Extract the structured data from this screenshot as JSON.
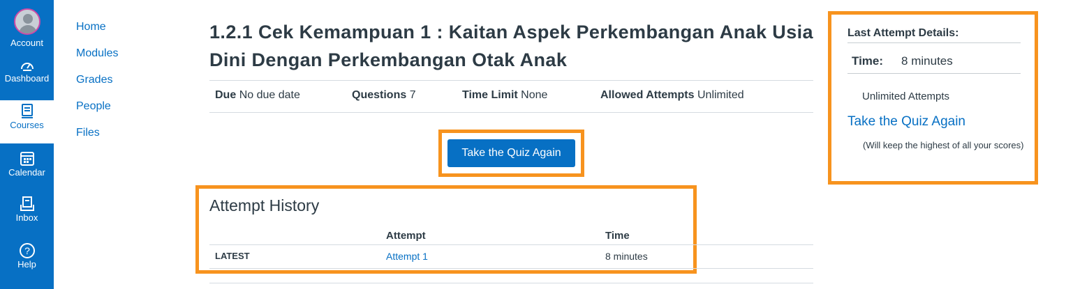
{
  "global_nav": {
    "items": [
      {
        "label": "Account",
        "icon": "avatar"
      },
      {
        "label": "Dashboard",
        "icon": "dashboard-icon"
      },
      {
        "label": "Courses",
        "icon": "courses-icon"
      },
      {
        "label": "Calendar",
        "icon": "calendar-icon"
      },
      {
        "label": "Inbox",
        "icon": "inbox-icon"
      },
      {
        "label": "Help",
        "icon": "help-icon"
      }
    ],
    "bg_color": "#0770c4"
  },
  "course_nav": {
    "items": [
      "Home",
      "Modules",
      "Grades",
      "People",
      "Files"
    ]
  },
  "quiz": {
    "title": "1.2.1 Cek Kemampuan 1 : Kaitan Aspek Perkembangan Anak Usia Dini Dengan Perkembangan Otak Anak",
    "meta": {
      "due_label": "Due",
      "due_value": "No due date",
      "questions_label": "Questions",
      "questions_value": "7",
      "time_limit_label": "Time Limit",
      "time_limit_value": "None",
      "attempts_label": "Allowed Attempts",
      "attempts_value": "Unlimited"
    },
    "retake_button": "Take the Quiz Again"
  },
  "attempt_history": {
    "title": "Attempt History",
    "columns": [
      "",
      "Attempt",
      "Time"
    ],
    "rows": [
      {
        "status": "LATEST",
        "attempt": "Attempt 1",
        "time": "8 minutes"
      }
    ]
  },
  "last_attempt": {
    "title": "Last Attempt Details:",
    "time_label": "Time:",
    "time_value": "8 minutes",
    "attempts_text": "Unlimited Attempts",
    "retake_link": "Take the Quiz Again",
    "note": "(Will keep the highest of all your scores)"
  },
  "colors": {
    "accent": "#0770c4",
    "highlight": "#f7931e"
  }
}
